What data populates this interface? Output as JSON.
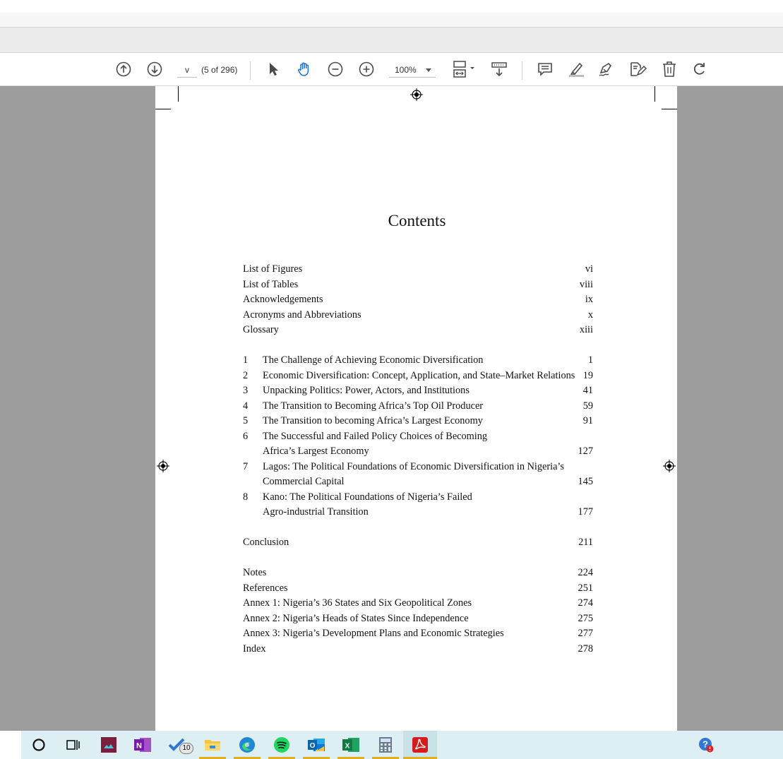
{
  "toolbar": {
    "page_input": "v",
    "page_count": "(5 of 296)",
    "zoom": "100%",
    "icons": [
      "prev-page-icon",
      "next-page-icon",
      "select-tool-icon",
      "hand-tool-icon",
      "zoom-out-icon",
      "zoom-in-icon",
      "page-fit-icon",
      "scroll-mode-icon",
      "comment-icon",
      "highlight-icon",
      "sign-icon",
      "edit-icon",
      "delete-icon",
      "rotate-icon"
    ]
  },
  "document": {
    "title": "Contents",
    "front_matter": [
      {
        "label": "List of Figures",
        "page": "vi"
      },
      {
        "label": "List of Tables",
        "page": "viii"
      },
      {
        "label": "Acknowledgements",
        "page": "ix"
      },
      {
        "label": "Acronyms and Abbreviations",
        "page": "x"
      },
      {
        "label": "Glossary",
        "page": "xiii"
      }
    ],
    "chapters": [
      {
        "num": "1",
        "line1": "The Challenge of Achieving Economic Diversification",
        "line2": "",
        "page": "1"
      },
      {
        "num": "2",
        "line1": "Economic Diversification: Concept, Application, and State–Market Relations",
        "line2": "",
        "page": "19"
      },
      {
        "num": "3",
        "line1": "Unpacking Politics: Power, Actors, and Institutions",
        "line2": "",
        "page": "41"
      },
      {
        "num": "4",
        "line1": "The Transition to Becoming Africa’s Top Oil Producer",
        "line2": "",
        "page": "59"
      },
      {
        "num": "5",
        "line1": "The Transition to becoming Africa’s Largest Economy",
        "line2": "",
        "page": "91"
      },
      {
        "num": "6",
        "line1": "The Successful and Failed Policy Choices of Becoming",
        "line2": "Africa’s Largest Economy",
        "page": "127"
      },
      {
        "num": "7",
        "line1": "Lagos: The Political Foundations of Economic Diversification in Nigeria’s",
        "line2": "Commercial Capital",
        "page": "145"
      },
      {
        "num": "8",
        "line1": "Kano: The Political Foundations of Nigeria’s Failed",
        "line2": "Agro-industrial Transition",
        "page": "177"
      }
    ],
    "conclusion": {
      "label": "Conclusion",
      "page": "211"
    },
    "back_matter": [
      {
        "label": "Notes",
        "page": "224"
      },
      {
        "label": "References",
        "page": "251"
      },
      {
        "label": "Annex 1: Nigeria’s 36 States and Six Geopolitical Zones",
        "page": "274"
      },
      {
        "label": "Annex 2: Nigeria’s Heads of States Since Independence",
        "page": "275"
      },
      {
        "label": "Annex 3: Nigeria’s Development Plans and Economic Strategies",
        "page": "277"
      },
      {
        "label": "Index",
        "page": "278"
      }
    ]
  },
  "taskbar": {
    "todo_badge": "10",
    "apps": [
      "cortana-icon",
      "task-view-icon",
      "photos-icon",
      "onenote-icon",
      "todo-icon",
      "file-explorer-icon",
      "edge-icon",
      "spotify-icon",
      "outlook-icon",
      "excel-icon",
      "calculator-icon",
      "acrobat-icon",
      "help-icon"
    ]
  },
  "colors": {
    "viewer_bg": "#9d9d9d",
    "taskbar_bg": "#ddeff2",
    "hand_tool_active": "#1473e6",
    "acrobat_red": "#d61b1f"
  }
}
